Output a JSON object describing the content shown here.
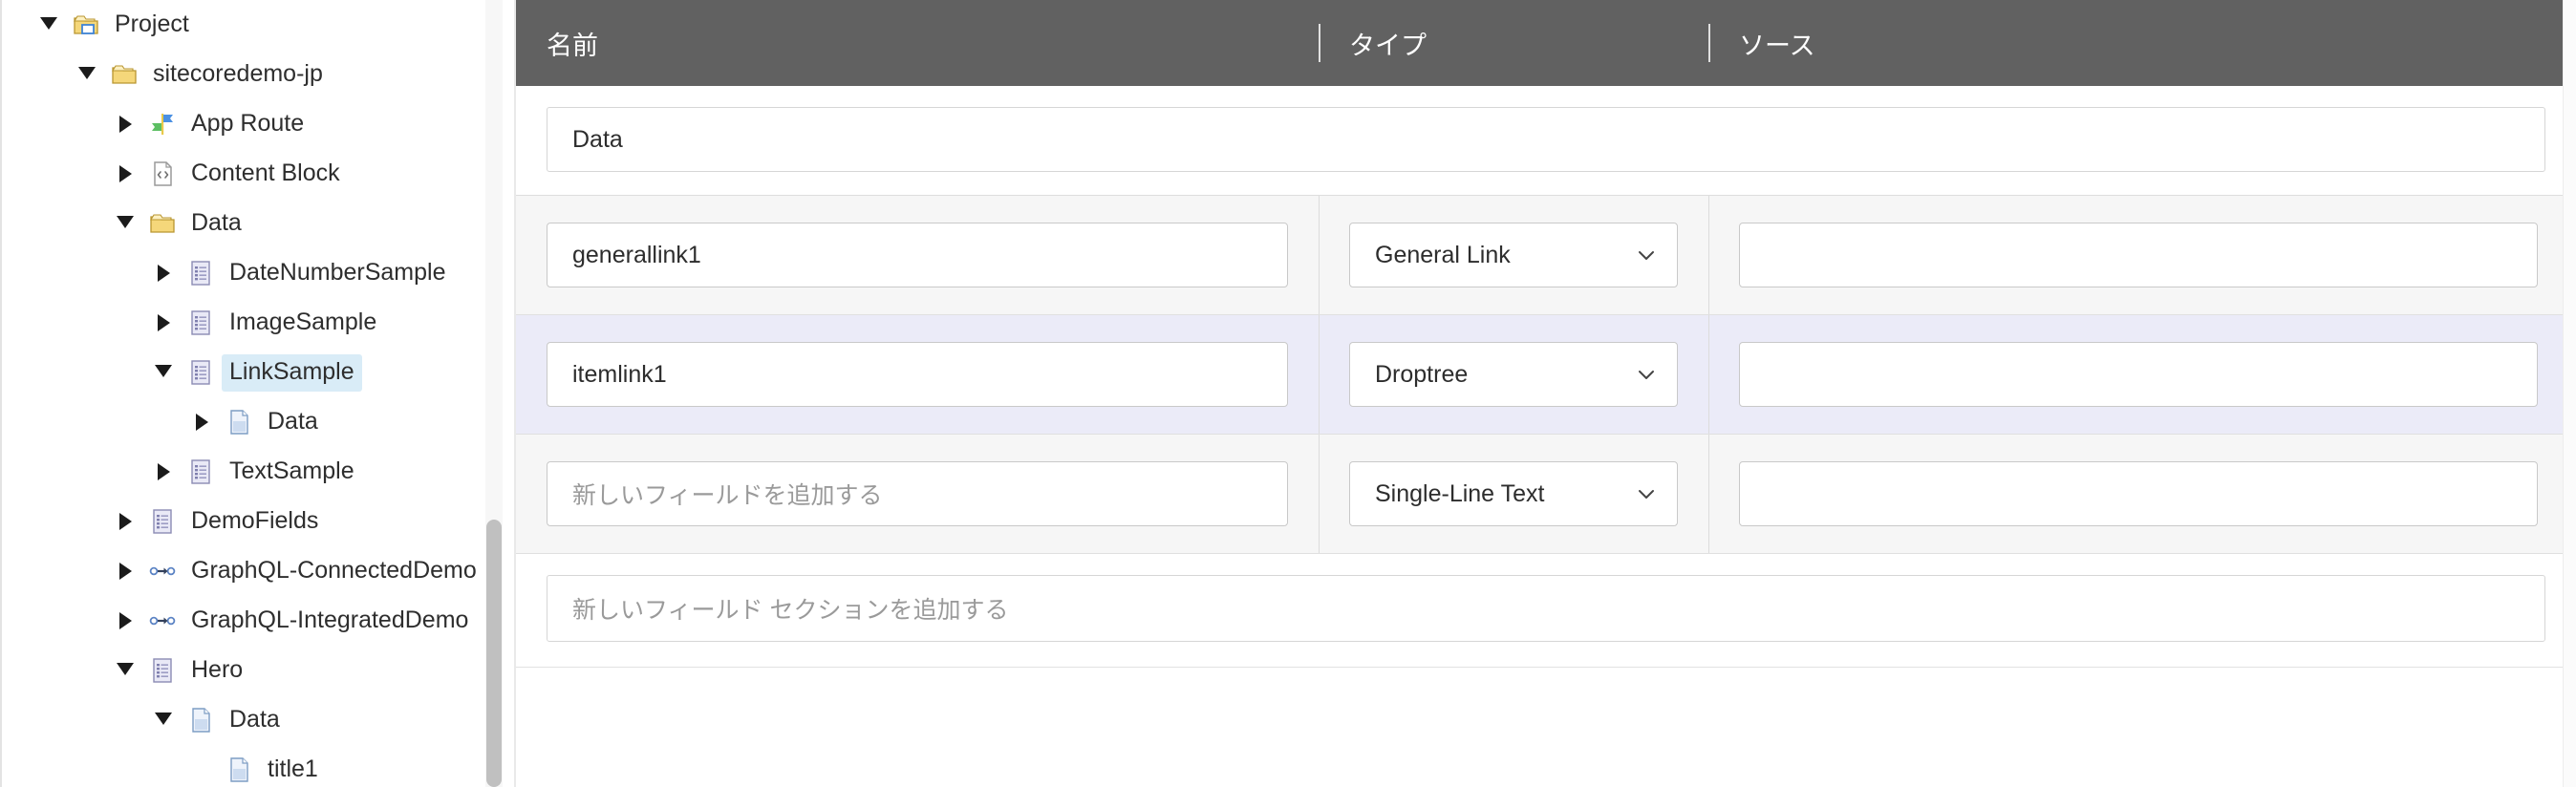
{
  "tree": {
    "items": [
      {
        "label": "Project",
        "depth": 1,
        "twisty": "expanded",
        "icon": "folder-project-icon",
        "selected": false
      },
      {
        "label": "sitecoredemo-jp",
        "depth": 2,
        "twisty": "expanded",
        "icon": "folder-icon",
        "selected": false
      },
      {
        "label": "App Route",
        "depth": 3,
        "twisty": "collapsed",
        "icon": "route-icon",
        "selected": false
      },
      {
        "label": "Content Block",
        "depth": 3,
        "twisty": "collapsed",
        "icon": "code-document-icon",
        "selected": false
      },
      {
        "label": "Data",
        "depth": 3,
        "twisty": "expanded",
        "icon": "folder-icon",
        "selected": false
      },
      {
        "label": "DateNumberSample",
        "depth": 4,
        "twisty": "collapsed",
        "icon": "template-icon",
        "selected": false
      },
      {
        "label": "ImageSample",
        "depth": 4,
        "twisty": "collapsed",
        "icon": "template-icon",
        "selected": false
      },
      {
        "label": "LinkSample",
        "depth": 4,
        "twisty": "expanded",
        "icon": "template-icon",
        "selected": true
      },
      {
        "label": "Data",
        "depth": 5,
        "twisty": "collapsed",
        "icon": "page-icon",
        "selected": false
      },
      {
        "label": "TextSample",
        "depth": 4,
        "twisty": "collapsed",
        "icon": "template-icon",
        "selected": false
      },
      {
        "label": "DemoFields",
        "depth": 3,
        "twisty": "collapsed",
        "icon": "template-icon",
        "selected": false
      },
      {
        "label": "GraphQL-ConnectedDemo",
        "depth": 3,
        "twisty": "collapsed",
        "icon": "graphql-icon",
        "selected": false
      },
      {
        "label": "GraphQL-IntegratedDemo",
        "depth": 3,
        "twisty": "collapsed",
        "icon": "graphql-icon",
        "selected": false
      },
      {
        "label": "Hero",
        "depth": 3,
        "twisty": "expanded",
        "icon": "template-icon",
        "selected": false
      },
      {
        "label": "Data",
        "depth": 4,
        "twisty": "expanded",
        "icon": "page-icon",
        "selected": false
      },
      {
        "label": "title1",
        "depth": 5,
        "twisty": "none",
        "icon": "page-icon",
        "selected": false
      }
    ]
  },
  "columns": {
    "name": "名前",
    "type": "タイプ",
    "source": "ソース"
  },
  "section": {
    "name": "Data"
  },
  "fields": [
    {
      "name": "generallink1",
      "name_placeholder": "",
      "type": "General Link",
      "source": "",
      "highlighted": false
    },
    {
      "name": "itemlink1",
      "name_placeholder": "",
      "type": "Droptree",
      "source": "",
      "highlighted": true
    },
    {
      "name": "",
      "name_placeholder": "新しいフィールドを追加する",
      "type": "Single-Line Text",
      "source": "",
      "highlighted": false
    }
  ],
  "add_section": {
    "placeholder": "新しいフィールド セクションを追加する"
  },
  "colors": {
    "header_bg": "#616161",
    "row_bg": "#f6f6f6",
    "row_highlight_bg": "#ebebf8",
    "tree_selected_bg": "#d9ecf7"
  }
}
